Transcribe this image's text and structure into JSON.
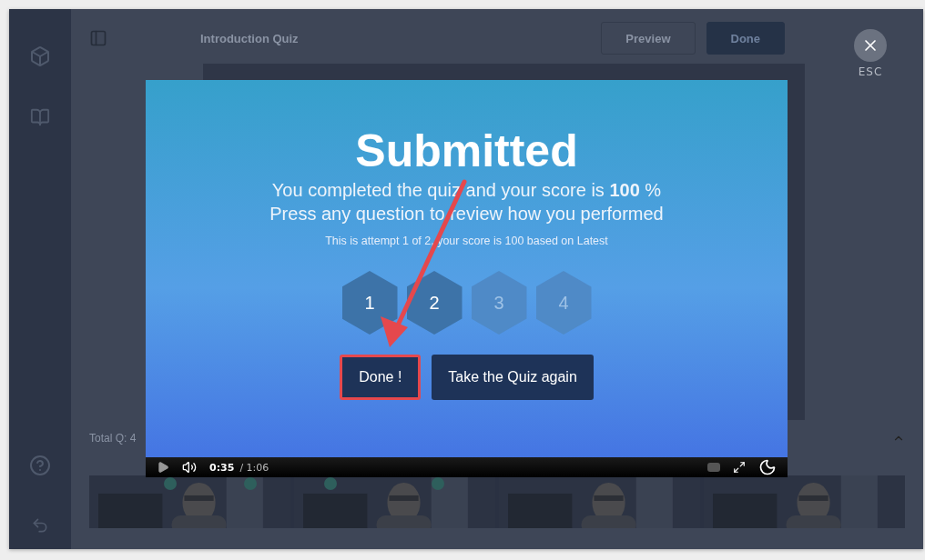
{
  "editor": {
    "title": "Introduction Quiz",
    "buttons": [
      {
        "label": "Preview",
        "kind": "outline"
      },
      {
        "label": "Done",
        "kind": "filled"
      }
    ],
    "total": "Total Q: 4"
  },
  "close": {
    "label": "ESC"
  },
  "modal": {
    "title": "Submitted",
    "message": "You completed the quiz and your score is **100** %",
    "instruction": "Press any question to review how you performed",
    "attempt": "This is attempt 1 of 2, your score is 100 based on Latest",
    "questions": [
      {
        "label": "1",
        "answered": true
      },
      {
        "label": "2",
        "answered": true
      },
      {
        "label": "3",
        "answered": false
      },
      {
        "label": "4",
        "answered": false
      }
    ],
    "buttons": [
      {
        "label": "Done !",
        "highlighted": true
      },
      {
        "label": "Take the Quiz again",
        "highlighted": false
      }
    ]
  },
  "player": {
    "time": "0:35",
    "duration": "/ 1:06"
  }
}
